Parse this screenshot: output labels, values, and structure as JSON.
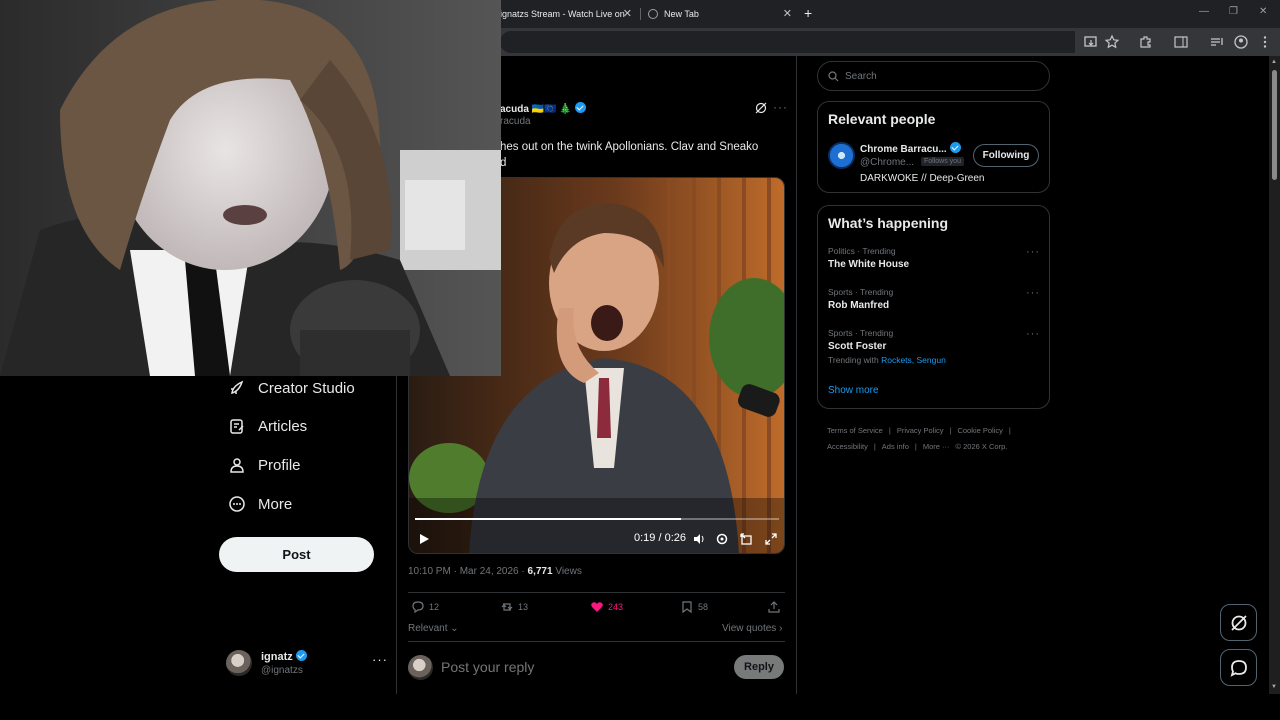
{
  "browser": {
    "tabs": [
      {
        "label": "ignatzs Stream - Watch Live on",
        "close": "✕"
      },
      {
        "label": "New Tab",
        "close": "✕"
      }
    ],
    "new_tab": "+",
    "window_controls": {
      "minimize": "—",
      "restore": "❐",
      "close": "✕"
    }
  },
  "nav": {
    "items": [
      {
        "label": "Creator Studio",
        "icon": "rocket-icon"
      },
      {
        "label": "Articles",
        "icon": "article-icon"
      },
      {
        "label": "Profile",
        "icon": "profile-icon"
      },
      {
        "label": "More",
        "icon": "more-circle-icon"
      }
    ],
    "post_label": "Post",
    "account": {
      "name": "ignatz",
      "handle": "@ignatzs",
      "more": "···"
    }
  },
  "tweet": {
    "name_partial": "acuda 🇺🇦🇪🇺 🎄",
    "handle_partial": "racuda",
    "more": "···",
    "text_line1": "hes out on the twink Apollonians. Clav and Sneako",
    "text_line2": "d",
    "video": {
      "time": "0:19 / 0:26",
      "progress": 0.73
    },
    "time": "10:10 PM · Mar 24, 2026 · ",
    "views_count": "6,771",
    "views_label": " Views",
    "actions": {
      "replies": "12",
      "reposts": "13",
      "likes": "243",
      "bookmarks": "58"
    },
    "sort_label": "Relevant",
    "quotes_label": "View quotes ›",
    "reply_placeholder": "Post your reply",
    "reply_button": "Reply"
  },
  "sidebar": {
    "search_placeholder": "Search",
    "relevant": {
      "title": "Relevant people",
      "name": "Chrome Barracu...",
      "handle": "@Chrome...",
      "follows_badge": "Follows you",
      "button": "Following",
      "bio": "DARKWOKE // Deep-Green"
    },
    "happening": {
      "title": "What’s happening",
      "trends": [
        {
          "category": "Politics · Trending",
          "title": "The White House"
        },
        {
          "category": "Sports · Trending",
          "title": "Rob Manfred"
        },
        {
          "category": "Sports · Trending",
          "title": "Scott Foster",
          "with_label": "Trending with ",
          "with_links": "Rockets, Sengun"
        }
      ],
      "more_dots": "···",
      "show_more": "Show more"
    },
    "footer": {
      "l1": [
        "Terms of Service",
        "|",
        "Privacy Policy",
        "|",
        "Cookie Policy",
        "|"
      ],
      "l2": [
        "Accessibility",
        "|",
        "Ads info",
        "|",
        "More ···",
        "© 2026 X Corp."
      ]
    }
  },
  "colors": {
    "accent": "#1d9bf0",
    "like": "#f91880",
    "border": "#2f3336",
    "muted": "#71767b"
  }
}
